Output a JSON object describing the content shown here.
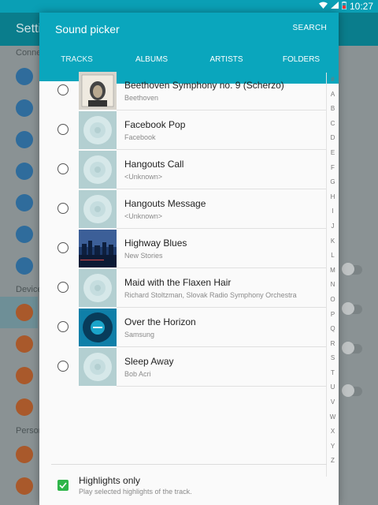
{
  "status_bar": {
    "time": "10:27"
  },
  "background": {
    "title": "Setti",
    "sections": [
      "Connec",
      "Device",
      "Person"
    ]
  },
  "dialog": {
    "title": "Sound picker",
    "search_label": "SEARCH",
    "tabs": [
      {
        "label": "TRACKS",
        "active": true
      },
      {
        "label": "ALBUMS",
        "active": false
      },
      {
        "label": "ARTISTS",
        "active": false
      },
      {
        "label": "FOLDERS",
        "active": false
      }
    ],
    "tracks": [
      {
        "title": "Beethoven Symphony no. 9 (Scherzo)",
        "artist": "Beethoven",
        "art": "portrait"
      },
      {
        "title": "Facebook Pop",
        "artist": "Facebook",
        "art": "disc"
      },
      {
        "title": "Hangouts Call",
        "artist": "<Unknown>",
        "art": "disc"
      },
      {
        "title": "Hangouts Message",
        "artist": "<Unknown>",
        "art": "disc"
      },
      {
        "title": "Highway Blues",
        "artist": "New Stories",
        "art": "city"
      },
      {
        "title": "Maid with the Flaxen Hair",
        "artist": "Richard Stoltzman, Slovak Radio Symphony Orchestra",
        "art": "disc"
      },
      {
        "title": "Over the Horizon",
        "artist": "Samsung",
        "art": "horizon"
      },
      {
        "title": "Sleep Away",
        "artist": "Bob Acri",
        "art": "disc"
      }
    ],
    "index_letters": [
      "#",
      "A",
      "B",
      "C",
      "D",
      "E",
      "F",
      "G",
      "H",
      "I",
      "J",
      "K",
      "L",
      "M",
      "N",
      "O",
      "P",
      "Q",
      "R",
      "S",
      "T",
      "U",
      "V",
      "W",
      "X",
      "Y",
      "Z"
    ],
    "highlights": {
      "label": "Highlights only",
      "description": "Play selected highlights of the track.",
      "checked": true
    }
  },
  "colors": {
    "accent": "#0aa6bd",
    "checkbox": "#2fb54a"
  }
}
